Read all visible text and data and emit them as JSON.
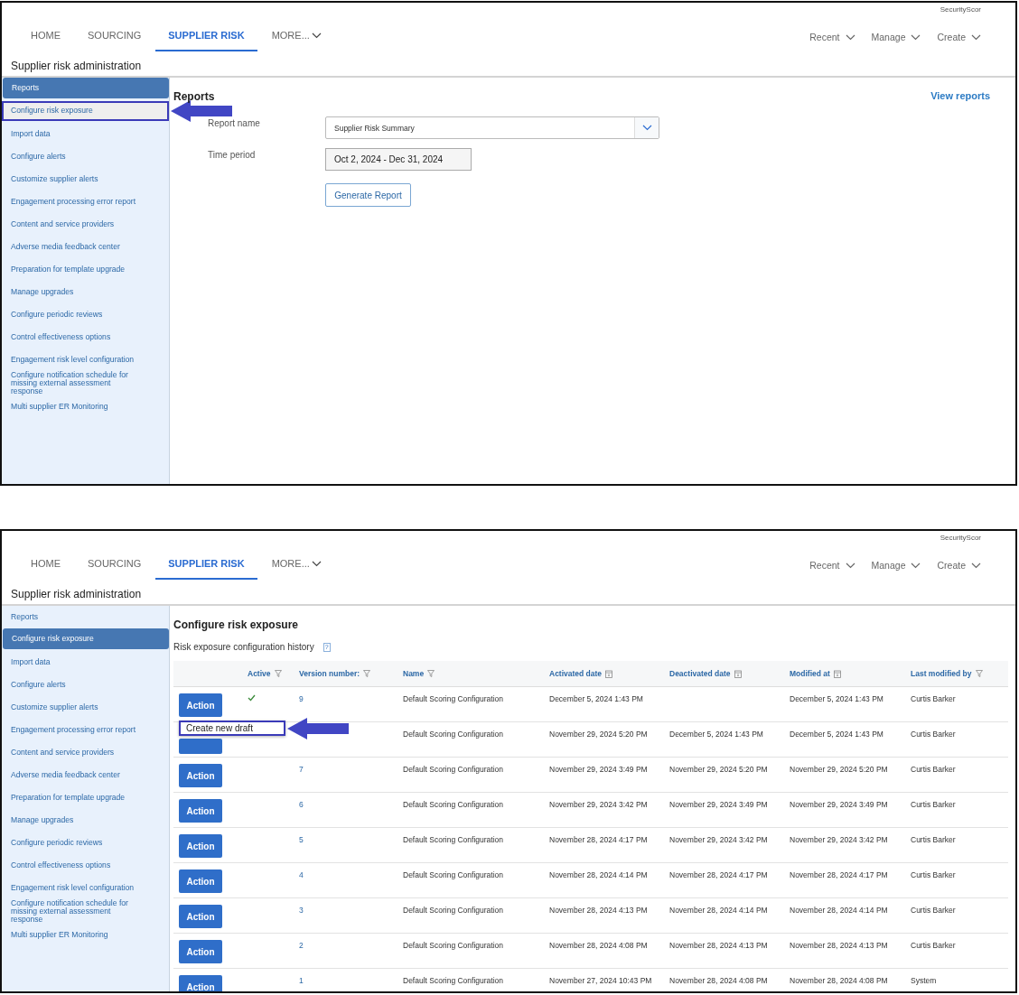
{
  "panels": [
    {
      "header": {
        "account": "SecurityScor",
        "tabs": [
          {
            "label": "HOME",
            "selected": false,
            "dropdown": false
          },
          {
            "label": "SOURCING",
            "selected": false,
            "dropdown": false
          },
          {
            "label": "SUPPLIER RISK",
            "selected": true,
            "dropdown": false
          },
          {
            "label": "MORE...",
            "selected": false,
            "dropdown": true
          }
        ],
        "menus": [
          "Recent",
          "Manage",
          "Create"
        ],
        "subtitle": "Supplier risk administration"
      },
      "sidebar": [
        {
          "label": "Reports",
          "selected": true,
          "outlined": false
        },
        {
          "label": "Configure risk exposure",
          "selected": false,
          "outlined": true
        },
        {
          "label": "Import data",
          "selected": false,
          "outlined": false
        },
        {
          "label": "Configure alerts",
          "selected": false,
          "outlined": false
        },
        {
          "label": "Customize supplier alerts",
          "selected": false,
          "outlined": false
        },
        {
          "label": "Engagement processing error report",
          "selected": false,
          "outlined": false
        },
        {
          "label": "Content and service providers",
          "selected": false,
          "outlined": false
        },
        {
          "label": "Adverse media feedback center",
          "selected": false,
          "outlined": false
        },
        {
          "label": "Preparation for template upgrade",
          "selected": false,
          "outlined": false
        },
        {
          "label": "Manage upgrades",
          "selected": false,
          "outlined": false
        },
        {
          "label": "Configure periodic reviews",
          "selected": false,
          "outlined": false
        },
        {
          "label": "Control effectiveness options",
          "selected": false,
          "outlined": false
        },
        {
          "label": "Engagement risk level configuration",
          "selected": false,
          "outlined": false
        },
        {
          "label": "Configure notification schedule for missing external assessment response",
          "selected": false,
          "outlined": false
        },
        {
          "label": "Multi supplier ER Monitoring",
          "selected": false,
          "outlined": false
        }
      ],
      "content": {
        "kind": "reports",
        "title": "Reports",
        "link": "View reports",
        "report_name_label": "Report name",
        "report_name_value": "Supplier Risk Summary",
        "time_period_label": "Time period",
        "time_period_value": "Oct 2, 2024 - Dec 31, 2024",
        "button": "Generate Report"
      }
    },
    {
      "header": {
        "account": "SecurityScor",
        "tabs": [
          {
            "label": "HOME",
            "selected": false,
            "dropdown": false
          },
          {
            "label": "SOURCING",
            "selected": false,
            "dropdown": false
          },
          {
            "label": "SUPPLIER RISK",
            "selected": true,
            "dropdown": false
          },
          {
            "label": "MORE...",
            "selected": false,
            "dropdown": true
          }
        ],
        "menus": [
          "Recent",
          "Manage",
          "Create"
        ],
        "subtitle": "Supplier risk administration"
      },
      "sidebar": [
        {
          "label": "Reports",
          "selected": false,
          "outlined": false
        },
        {
          "label": "Configure risk exposure",
          "selected": true,
          "outlined": false
        },
        {
          "label": "Import data",
          "selected": false,
          "outlined": false
        },
        {
          "label": "Configure alerts",
          "selected": false,
          "outlined": false
        },
        {
          "label": "Customize supplier alerts",
          "selected": false,
          "outlined": false
        },
        {
          "label": "Engagement processing error report",
          "selected": false,
          "outlined": false
        },
        {
          "label": "Content and service providers",
          "selected": false,
          "outlined": false
        },
        {
          "label": "Adverse media feedback center",
          "selected": false,
          "outlined": false
        },
        {
          "label": "Preparation for template upgrade",
          "selected": false,
          "outlined": false
        },
        {
          "label": "Manage upgrades",
          "selected": false,
          "outlined": false
        },
        {
          "label": "Configure periodic reviews",
          "selected": false,
          "outlined": false
        },
        {
          "label": "Control effectiveness options",
          "selected": false,
          "outlined": false
        },
        {
          "label": "Engagement risk level configuration",
          "selected": false,
          "outlined": false
        },
        {
          "label": "Configure notification schedule for missing external assessment response",
          "selected": false,
          "outlined": false
        },
        {
          "label": "Multi supplier ER Monitoring",
          "selected": false,
          "outlined": false
        }
      ],
      "content": {
        "kind": "table",
        "title": "Configure risk exposure",
        "subtitle": "Risk exposure configuration history",
        "help": "?",
        "columns": [
          {
            "label": "Active",
            "kind": "filter"
          },
          {
            "label": "Version number:",
            "kind": "filter"
          },
          {
            "label": "Name",
            "kind": "filter"
          },
          {
            "label": "Activated date",
            "kind": "calendar"
          },
          {
            "label": "Deactivated date",
            "kind": "calendar"
          },
          {
            "label": "Modified at",
            "kind": "calendar"
          },
          {
            "label": "Last modified by",
            "kind": "filter"
          }
        ],
        "rows": [
          {
            "action": "Action",
            "menu": {
              "item": "Create new draft",
              "outlined": true
            },
            "active": true,
            "version": "9",
            "name": "Default Scoring Configuration",
            "activated": "December 5, 2024 1:43 PM",
            "modified": "December 5, 2024 1:43 PM",
            "by": "Curtis Barker"
          },
          {
            "name": "Default Scoring Configuration",
            "activated": "November 29, 2024 5:20 PM",
            "deactivated": "December 5, 2024 1:43 PM",
            "modified": "December 5, 2024 1:43 PM",
            "by": "Curtis Barker"
          },
          {
            "action": "Action",
            "active": false,
            "version": "7",
            "name": "Default Scoring Configuration",
            "activated": "November 29, 2024 3:49 PM",
            "deactivated": "November 29, 2024 5:20 PM",
            "modified": "November 29, 2024 5:20 PM",
            "by": "Curtis Barker"
          },
          {
            "action": "Action",
            "active": false,
            "version": "6",
            "name": "Default Scoring Configuration",
            "activated": "November 29, 2024 3:42 PM",
            "deactivated": "November 29, 2024 3:49 PM",
            "modified": "November 29, 2024 3:49 PM",
            "by": "Curtis Barker"
          },
          {
            "action": "Action",
            "active": false,
            "version": "5",
            "name": "Default Scoring Configuration",
            "activated": "November 28, 2024 4:17 PM",
            "deactivated": "November 29, 2024 3:42 PM",
            "modified": "November 29, 2024 3:42 PM",
            "by": "Curtis Barker"
          },
          {
            "action": "Action",
            "active": false,
            "version": "4",
            "name": "Default Scoring Configuration",
            "activated": "November 28, 2024 4:14 PM",
            "deactivated": "November 28, 2024 4:17 PM",
            "modified": "November 28, 2024 4:17 PM",
            "by": "Curtis Barker"
          },
          {
            "action": "Action",
            "active": false,
            "version": "3",
            "name": "Default Scoring Configuration",
            "activated": "November 28, 2024 4:13 PM",
            "deactivated": "November 28, 2024 4:14 PM",
            "modified": "November 28, 2024 4:14 PM",
            "by": "Curtis Barker"
          },
          {
            "action": "Action",
            "active": false,
            "version": "2",
            "name": "Default Scoring Configuration",
            "activated": "November 28, 2024 4:08 PM",
            "deactivated": "November 28, 2024 4:13 PM",
            "modified": "November 28, 2024 4:13 PM",
            "by": "Curtis Barker"
          },
          {
            "action": "Action",
            "active": false,
            "version": "1",
            "name": "Default Scoring Configuration",
            "activated": "November 27, 2024 10:43 PM",
            "deactivated": "November 28, 2024 4:08 PM",
            "modified": "November 28, 2024 4:08 PM",
            "by": "System"
          }
        ]
      }
    }
  ]
}
